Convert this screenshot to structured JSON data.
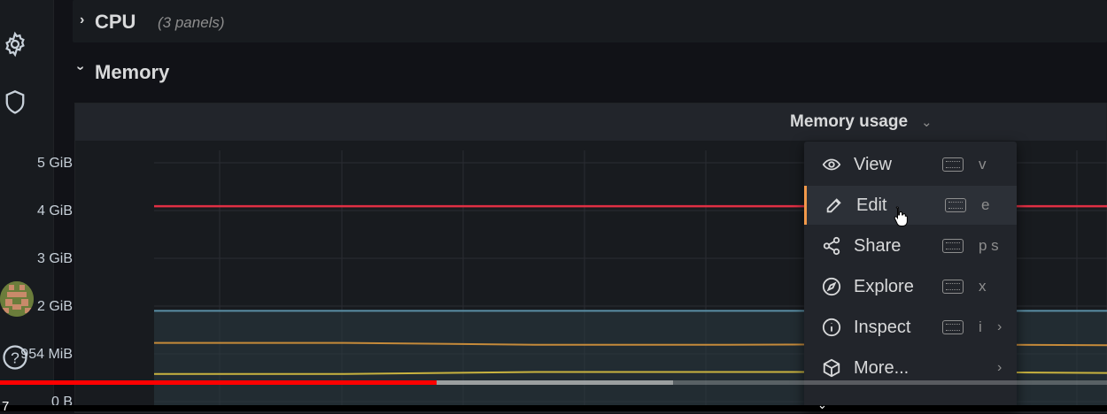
{
  "sidebar": {
    "icons": [
      "gear-icon",
      "shield-icon",
      "avatar",
      "help-icon"
    ],
    "help_glyph": "?"
  },
  "rows": {
    "cpu": {
      "title": "CPU",
      "subtitle": "(3 panels)",
      "collapsed": true
    },
    "memory": {
      "title": "Memory",
      "collapsed": false
    }
  },
  "panel": {
    "title": "Memory usage",
    "y_ticks": [
      "5 GiB",
      "4 GiB",
      "3 GiB",
      "2 GiB",
      "954 MiB",
      "0 B"
    ]
  },
  "chart_data": {
    "type": "line",
    "title": "Memory usage",
    "y_ticks": [
      "5 GiB",
      "4 GiB",
      "3 GiB",
      "2 GiB",
      "954 MiB",
      "0 B"
    ],
    "series": [
      {
        "color": "#e02f44",
        "values_gib": [
          4.09,
          4.09,
          4.09,
          4.09,
          4.09,
          4.09
        ]
      },
      {
        "color": "#5a8fa6",
        "values_gib": [
          1.9,
          1.9,
          1.9,
          1.9,
          1.9,
          1.9
        ]
      },
      {
        "color": "#c58a3a",
        "values_gib": [
          1.23,
          1.23,
          1.19,
          1.19,
          1.2,
          1.18
        ]
      },
      {
        "color": "#c9b33f",
        "values_gib": [
          0.58,
          0.58,
          0.62,
          0.62,
          0.62,
          0.6
        ]
      }
    ]
  },
  "menu": {
    "items": [
      {
        "label": "View",
        "icon": "eye-icon",
        "shortcut": "v",
        "kbd": true,
        "submenu": false,
        "active": false
      },
      {
        "label": "Edit",
        "icon": "edit-icon",
        "shortcut": "e",
        "kbd": true,
        "submenu": false,
        "active": true
      },
      {
        "label": "Share",
        "icon": "share-icon",
        "shortcut": "p s",
        "kbd": true,
        "submenu": false,
        "active": false
      },
      {
        "label": "Explore",
        "icon": "compass-icon",
        "shortcut": "x",
        "kbd": true,
        "submenu": false,
        "active": false
      },
      {
        "label": "Inspect",
        "icon": "info-icon",
        "shortcut": "i",
        "kbd": true,
        "submenu": true,
        "active": false
      },
      {
        "label": "More...",
        "icon": "cube-icon",
        "shortcut": "",
        "kbd": false,
        "submenu": true,
        "active": false
      }
    ]
  },
  "video": {
    "time_fragment": "7",
    "played_fraction": 0.394,
    "buffered_fraction": 0.608
  },
  "colors": {
    "accent": "#f2994a",
    "background": "#111217",
    "panel": "#181b1f"
  }
}
